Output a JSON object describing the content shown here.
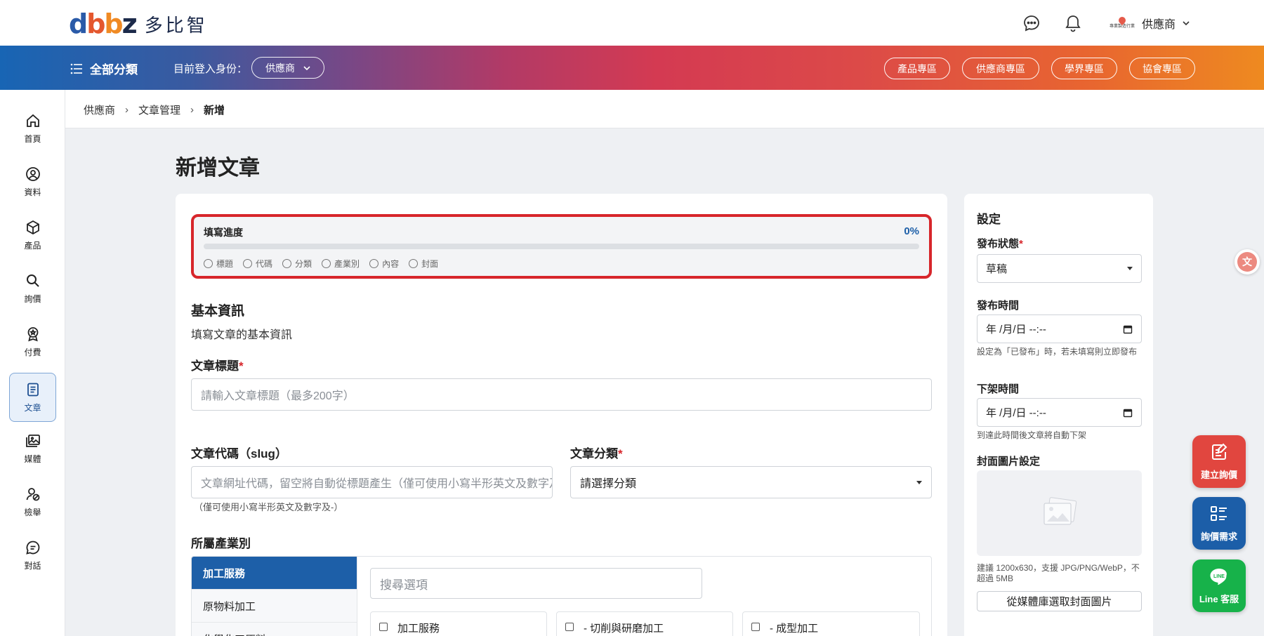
{
  "header": {
    "logo_mark": [
      "d",
      "b",
      "b",
      "z"
    ],
    "logo_text": "多比智",
    "user_name": "供應商",
    "user_logo_text": "專業製造行業"
  },
  "navbar": {
    "all_categories": "全部分類",
    "login_as_label": "目前登入身份：",
    "role": "供應商",
    "zones": [
      "產品專區",
      "供應商專區",
      "學界專區",
      "協會專區"
    ]
  },
  "sidebar": {
    "items": [
      {
        "label": "首頁",
        "icon": "home-icon"
      },
      {
        "label": "資料",
        "icon": "user-circle-icon"
      },
      {
        "label": "產品",
        "icon": "box-icon"
      },
      {
        "label": "詢價",
        "icon": "search-icon"
      },
      {
        "label": "付費",
        "icon": "badge-icon"
      },
      {
        "label": "文章",
        "icon": "article-icon"
      },
      {
        "label": "媒體",
        "icon": "media-icon"
      },
      {
        "label": "檢舉",
        "icon": "report-icon"
      },
      {
        "label": "對話",
        "icon": "chat-icon"
      }
    ],
    "active": "文章"
  },
  "breadcrumb": [
    "供應商",
    "文章管理",
    "新增"
  ],
  "page": {
    "title": "新增文章"
  },
  "progress": {
    "label": "填寫進度",
    "percent_text": "0%",
    "value": 0,
    "steps": [
      "標題",
      "代碼",
      "分類",
      "產業別",
      "內容",
      "封面"
    ]
  },
  "form": {
    "section_title": "基本資訊",
    "section_subtitle": "填寫文章的基本資訊",
    "title_label": "文章標題",
    "title_placeholder": "請輸入文章標題（最多200字）",
    "slug_label": "文章代碼（slug）",
    "slug_placeholder": "文章網址代碼，留空將自動從標題產生（僅可使用小寫半形英文及數字及-）",
    "slug_hint": "（僅可使用小寫半形英文及數字及-）",
    "category_label": "文章分類",
    "category_placeholder": "請選擇分類",
    "industry_label": "所屬產業別",
    "industry_categories": [
      "加工服務",
      "原物料加工",
      "化學化工原料"
    ],
    "industry_search_placeholder": "搜尋選項",
    "industry_options": [
      "加工服務",
      "- 切削與研磨加工",
      "- 成型加工"
    ]
  },
  "settings": {
    "title": "設定",
    "status_label": "發布狀態",
    "status_value": "草稿",
    "publish_label": "發布時間",
    "publish_value": "年 /月/日 --:--",
    "publish_hint": "設定為「已發布」時，若未填寫則立即發布",
    "unpublish_label": "下架時間",
    "unpublish_value": "年 /月/日 --:--",
    "unpublish_hint": "到達此時間後文章將自動下架",
    "cover_label": "封面圖片設定",
    "cover_hint": "建議 1200x630，支援 JPG/PNG/WebP，不超過 5MB",
    "media_button": "從媒體庫選取封面圖片"
  },
  "fabs": [
    {
      "label": "建立詢價",
      "color": "#e1463f"
    },
    {
      "label": "詢價需求",
      "color": "#1c5ea8"
    },
    {
      "label": "Line 客服",
      "color": "#17b24a"
    }
  ],
  "colors": {
    "accent": "#1d5fa8",
    "required": "#d7262b",
    "highlight": "#d7262b"
  }
}
